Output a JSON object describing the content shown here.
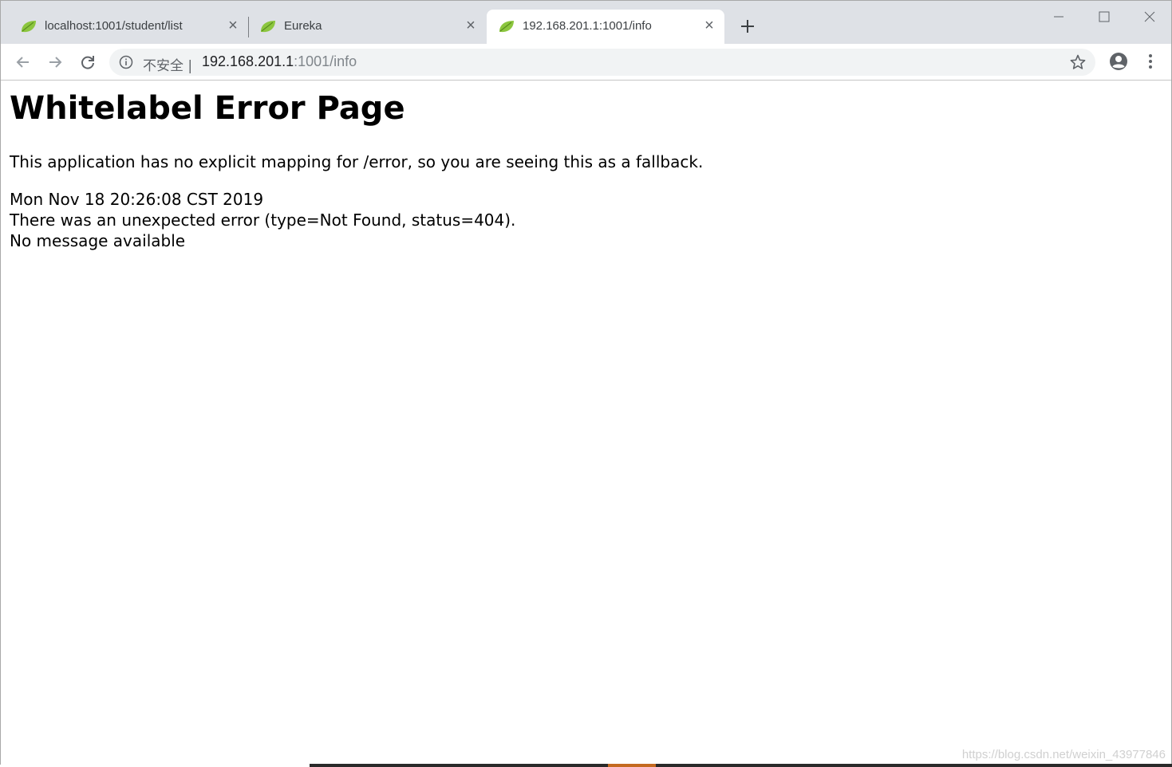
{
  "browser": {
    "tabs": [
      {
        "title": "localhost:1001/student/list",
        "active": false,
        "favicon": "spring-leaf-icon"
      },
      {
        "title": "Eureka",
        "active": false,
        "favicon": "spring-leaf-icon"
      },
      {
        "title": "192.168.201.1:1001/info",
        "active": true,
        "favicon": "spring-leaf-icon"
      }
    ],
    "address_bar": {
      "security_label": "不安全 |",
      "url_host": "192.168.201.1",
      "url_path": ":1001/info"
    }
  },
  "page": {
    "heading": "Whitelabel Error Page",
    "description": "This application has no explicit mapping for /error, so you are seeing this as a fallback.",
    "timestamp": "Mon Nov 18 20:26:08 CST 2019",
    "error_line": "There was an unexpected error (type=Not Found, status=404).",
    "message": "No message available"
  },
  "watermark": "https://blog.csdn.net/weixin_43977846",
  "colors": {
    "tabstrip_bg": "#dee1e6",
    "omnibox_bg": "#f1f3f4",
    "favicon_green": "#8cc63f"
  }
}
